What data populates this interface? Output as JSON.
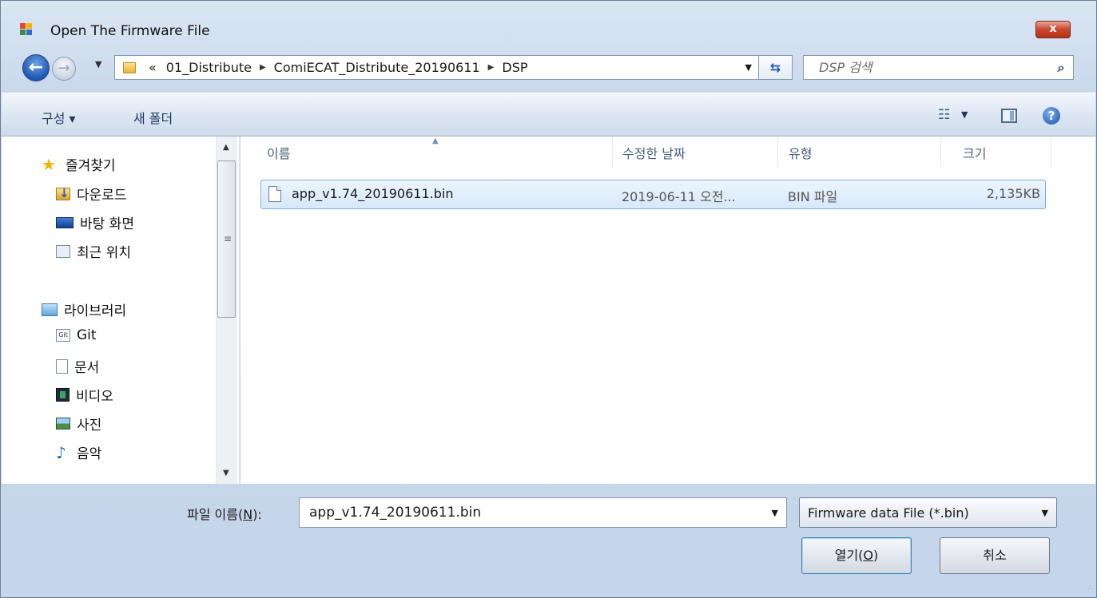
{
  "window": {
    "title": "Open The Firmware File",
    "close_label": "x"
  },
  "nav": {
    "breadcrumb": [
      {
        "label": "«"
      },
      {
        "label": "01_Distribute"
      },
      {
        "label": "ComiECAT_Distribute_20190611"
      },
      {
        "label": "DSP"
      }
    ],
    "search_placeholder": "DSP 검색"
  },
  "toolbar": {
    "organize_label": "구성 ▾",
    "new_folder_label": "새 폴더"
  },
  "sidebar": {
    "favorites": {
      "label": "즐겨찾기",
      "icon": "star-icon"
    },
    "favorite_items": [
      {
        "label": "다운로드",
        "icon": "downloads-folder-icon"
      },
      {
        "label": "바탕 화면",
        "icon": "desktop-icon"
      },
      {
        "label": "최근 위치",
        "icon": "recent-places-icon"
      }
    ],
    "libraries": {
      "label": "라이브러리",
      "icon": "library-icon"
    },
    "library_items": [
      {
        "label": "Git",
        "icon": "git-library-icon"
      },
      {
        "label": "문서",
        "icon": "documents-icon"
      },
      {
        "label": "비디오",
        "icon": "videos-icon"
      },
      {
        "label": "사진",
        "icon": "pictures-icon"
      },
      {
        "label": "음악",
        "icon": "music-icon"
      }
    ]
  },
  "filelist": {
    "columns": [
      "이름",
      "수정한 날짜",
      "유형",
      "크기"
    ],
    "files": [
      {
        "name": "app_v1.74_20190611.bin",
        "date": "2019-06-11 오전...",
        "type": "BIN 파일",
        "size": "2,135KB"
      }
    ]
  },
  "bottom": {
    "filename_label": "파일 이름(",
    "filename_accel": "N",
    "filename_label_end": "):",
    "filename_value": "app_v1.74_20190611.bin",
    "filter_value": "Firmware data File  (*.bin)",
    "open_label": "열기(",
    "open_accel": "O",
    "open_label_end": ")",
    "cancel_label": "취소"
  },
  "colors": {
    "selection": "#d6e8fb",
    "accent": "#1d56b5"
  }
}
